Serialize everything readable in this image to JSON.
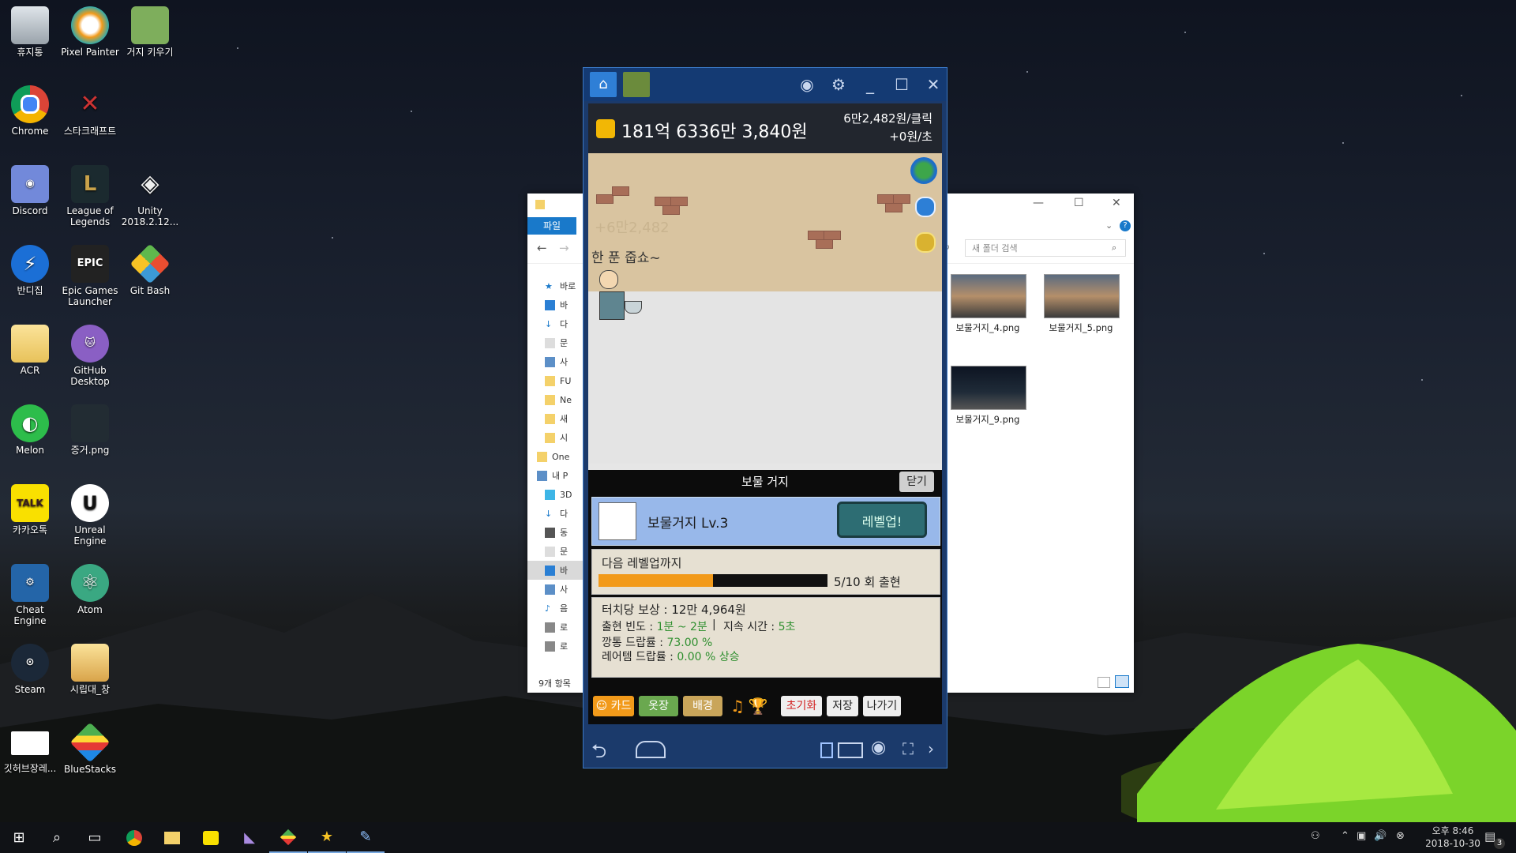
{
  "desktop": {
    "icons": [
      {
        "label": "휴지통",
        "icon": "recycle-bin-icon"
      },
      {
        "label": "Pixel Painter",
        "icon": "pixel-painter-icon"
      },
      {
        "label": "거지 키우기",
        "icon": "beggar-game-icon"
      },
      {
        "label": "Chrome",
        "icon": "chrome-icon"
      },
      {
        "label": "스타크래프트",
        "icon": "starcraft-icon"
      },
      {
        "label": "Discord",
        "icon": "discord-icon"
      },
      {
        "label": "League of Legends",
        "icon": "league-icon"
      },
      {
        "label": "Unity 2018.2.12...",
        "icon": "unity-icon"
      },
      {
        "label": "반디집",
        "icon": "bandizip-icon"
      },
      {
        "label": "Epic Games Launcher",
        "icon": "epic-games-icon"
      },
      {
        "label": "Git Bash",
        "icon": "git-bash-icon"
      },
      {
        "label": "ACR",
        "icon": "folder-icon"
      },
      {
        "label": "GitHub Desktop",
        "icon": "github-icon"
      },
      {
        "label": "Melon",
        "icon": "melon-icon"
      },
      {
        "label": "증거.png",
        "icon": "image-file-icon"
      },
      {
        "label": "카카오톡",
        "icon": "kakaotalk-icon"
      },
      {
        "label": "Unreal Engine",
        "icon": "unreal-icon"
      },
      {
        "label": "Cheat Engine",
        "icon": "cheat-engine-icon"
      },
      {
        "label": "Atom",
        "icon": "atom-icon"
      },
      {
        "label": "Steam",
        "icon": "steam-icon"
      },
      {
        "label": "시립대_창",
        "icon": "folder-icon"
      },
      {
        "label": "깃허브장레...",
        "icon": "document-icon"
      },
      {
        "label": "BlueStacks",
        "icon": "bluestacks-icon"
      }
    ],
    "kakao_badge": "TALK",
    "epic_badge": "EPIC"
  },
  "explorer": {
    "ribbon_tab": "파일",
    "search_placeholder": "새 폴더 검색",
    "status": "9개 항목",
    "sidebar": [
      "바로",
      "바",
      "다",
      "문",
      "사",
      "FU",
      "Ne",
      "새",
      "시",
      "One",
      "내 P",
      "3D",
      "다",
      "동",
      "문",
      "바",
      "사",
      "음",
      "로",
      "로"
    ],
    "files": [
      {
        "name": "보물거지_4.png"
      },
      {
        "name": "보물거지_5.png"
      },
      {
        "name": "보물거지_9.png"
      }
    ]
  },
  "bluestacks": {
    "money": "181억 6336만 3,840원",
    "per_click": "6만2,482원/클릭",
    "per_sec": "+0원/초",
    "scene_ghost": "+6만2,482",
    "speech": "한 푼 줍쇼~",
    "panel_title": "보물 거지",
    "close_button": "닫기",
    "card_name": "보물거지 Lv.3",
    "levelup_button": "레벨업!",
    "next_level_label": "다음 레벨업까지",
    "progress_value": 0.5,
    "progress_text": "5/10 회 출현",
    "stats": {
      "touch_reward": "터치당 보상 : 12만 4,964원",
      "freq_label": "출현 빈도 : ",
      "freq_value": "1분 ~ 2분",
      "sep": "|",
      "duration_label": "지속 시간 : ",
      "duration_value": "5초",
      "can_label": "깡통 드랍률 : ",
      "can_value": "73.00 %",
      "rare_label": "레어템 드랍률 : ",
      "rare_value": "0.00 % 상승"
    },
    "bottom_buttons": {
      "card": "카드",
      "clothes": "옷장",
      "background": "배경",
      "reset": "초기화",
      "save": "저장",
      "exit": "나가기"
    },
    "colors": {
      "accent_green": "#2f8f2f",
      "progress_orange": "#f29a1a",
      "levelup_teal": "#2d6d73",
      "reset_red": "#d21e1e"
    }
  },
  "taskbar": {
    "time": "오후 8:46",
    "date": "2018-10-30",
    "notification_count": "3"
  }
}
